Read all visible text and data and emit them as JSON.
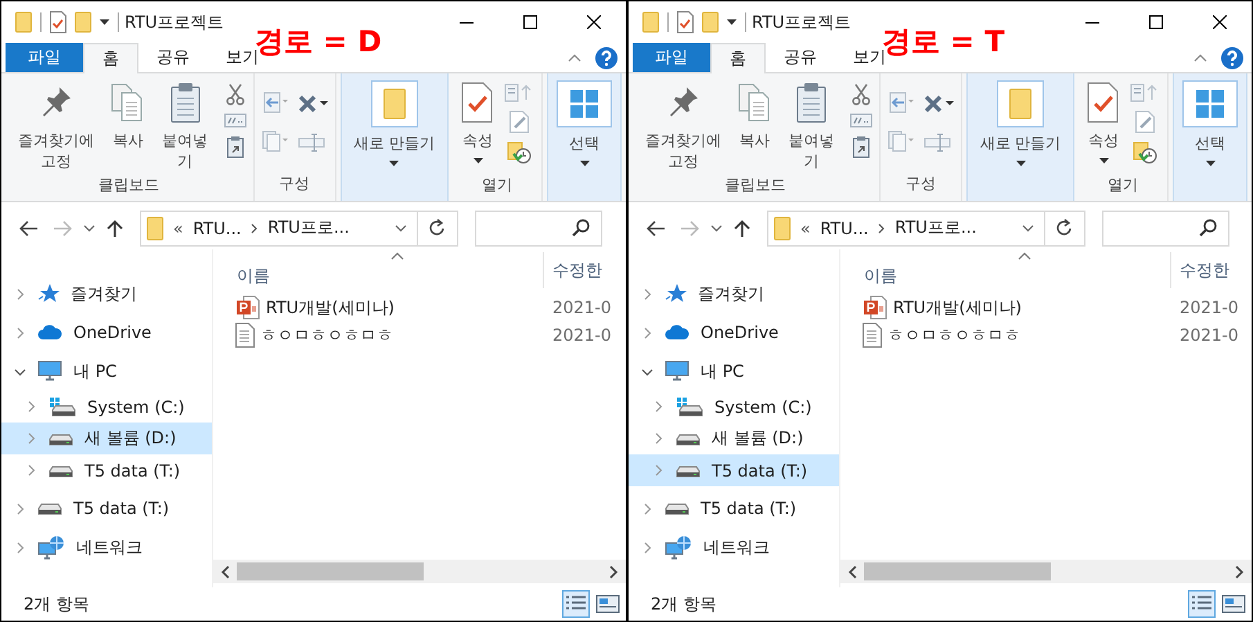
{
  "windows": [
    {
      "title": "RTU프로젝트",
      "annotation": "경로 = D",
      "tabs": [
        {
          "label": "파일",
          "kind": "file",
          "selected": false
        },
        {
          "label": "홈",
          "kind": "tab",
          "selected": true
        },
        {
          "label": "공유",
          "kind": "tab",
          "selected": false
        },
        {
          "label": "보기",
          "kind": "tab",
          "selected": false
        }
      ],
      "ribbon": [
        {
          "label": "클립보드",
          "highlighted": false,
          "items": [
            {
              "kind": "pin",
              "label": "즐겨찾기에 고정"
            },
            {
              "kind": "copy",
              "label": "복사"
            },
            {
              "kind": "paste",
              "label": "붙여넣기"
            },
            {
              "kind": "clip-stack"
            }
          ]
        },
        {
          "label": "구성",
          "highlighted": false,
          "items": [
            {
              "kind": "move-stack"
            },
            {
              "kind": "delete-stack"
            }
          ]
        },
        {
          "highlighted": true,
          "items": [
            {
              "kind": "new-folder",
              "label": "새로 만들기",
              "dropdown": true
            }
          ]
        },
        {
          "label": "열기",
          "highlighted": false,
          "items": [
            {
              "kind": "properties",
              "label": "속성",
              "dropdown": true
            },
            {
              "kind": "open-stack"
            }
          ]
        },
        {
          "highlighted": true,
          "items": [
            {
              "kind": "select",
              "label": "선택",
              "dropdown": true
            }
          ]
        }
      ],
      "address": {
        "overflow": "«",
        "crumbs": [
          "RTU...",
          "RTU프로..."
        ]
      },
      "nav": [
        {
          "label": "즐겨찾기",
          "kind": "star",
          "expanded": false,
          "selected": false
        },
        {
          "label": "OneDrive",
          "kind": "cloud",
          "expanded": false,
          "selected": false
        },
        {
          "label": "내 PC",
          "kind": "pc",
          "expanded": true,
          "selected": false,
          "children": [
            {
              "label": "System (C:)",
              "kind": "system-drive",
              "expanded": false,
              "selected": false
            },
            {
              "label": "새 볼륨 (D:)",
              "kind": "drive",
              "expanded": false,
              "selected": true
            },
            {
              "label": "T5 data (T:)",
              "kind": "drive",
              "expanded": false,
              "selected": false
            }
          ]
        },
        {
          "label": "T5 data (T:)",
          "kind": "drive",
          "expanded": false,
          "selected": false
        },
        {
          "label": "네트워크",
          "kind": "network",
          "expanded": false,
          "selected": false
        }
      ],
      "columns": [
        {
          "label": "이름",
          "sorted": true
        },
        {
          "label": "수정한",
          "sorted": false
        }
      ],
      "files": [
        {
          "name": "RTU개발(세미나)",
          "modified": "2021-0",
          "kind": "pptx"
        },
        {
          "name": "ㅎㅇㅁㅎㅇㅎㅁㅎ",
          "modified": "2021-0",
          "kind": "text"
        }
      ],
      "status": "2개 항목",
      "views": [
        {
          "kind": "details",
          "selected": true
        },
        {
          "kind": "tiles",
          "selected": false
        }
      ]
    },
    {
      "title": "RTU프로젝트",
      "annotation": "경로 = T",
      "tabs": [
        {
          "label": "파일",
          "kind": "file",
          "selected": false
        },
        {
          "label": "홈",
          "kind": "tab",
          "selected": true
        },
        {
          "label": "공유",
          "kind": "tab",
          "selected": false
        },
        {
          "label": "보기",
          "kind": "tab",
          "selected": false
        }
      ],
      "ribbon": [
        {
          "label": "클립보드",
          "highlighted": false,
          "items": [
            {
              "kind": "pin",
              "label": "즐겨찾기에 고정"
            },
            {
              "kind": "copy",
              "label": "복사"
            },
            {
              "kind": "paste",
              "label": "붙여넣기"
            },
            {
              "kind": "clip-stack"
            }
          ]
        },
        {
          "label": "구성",
          "highlighted": false,
          "items": [
            {
              "kind": "move-stack"
            },
            {
              "kind": "delete-stack"
            }
          ]
        },
        {
          "highlighted": true,
          "items": [
            {
              "kind": "new-folder",
              "label": "새로 만들기",
              "dropdown": true
            }
          ]
        },
        {
          "label": "열기",
          "highlighted": false,
          "items": [
            {
              "kind": "properties",
              "label": "속성",
              "dropdown": true
            },
            {
              "kind": "open-stack"
            }
          ]
        },
        {
          "highlighted": true,
          "items": [
            {
              "kind": "select",
              "label": "선택",
              "dropdown": true
            }
          ]
        }
      ],
      "address": {
        "overflow": "«",
        "crumbs": [
          "RTU...",
          "RTU프로..."
        ]
      },
      "nav": [
        {
          "label": "즐겨찾기",
          "kind": "star",
          "expanded": false,
          "selected": false
        },
        {
          "label": "OneDrive",
          "kind": "cloud",
          "expanded": false,
          "selected": false
        },
        {
          "label": "내 PC",
          "kind": "pc",
          "expanded": true,
          "selected": false,
          "children": [
            {
              "label": "System (C:)",
              "kind": "system-drive",
              "expanded": false,
              "selected": false
            },
            {
              "label": "새 볼륨 (D:)",
              "kind": "drive",
              "expanded": false,
              "selected": false
            },
            {
              "label": "T5 data (T:)",
              "kind": "drive",
              "expanded": false,
              "selected": true
            }
          ]
        },
        {
          "label": "T5 data (T:)",
          "kind": "drive",
          "expanded": false,
          "selected": false
        },
        {
          "label": "네트워크",
          "kind": "network",
          "expanded": false,
          "selected": false
        }
      ],
      "columns": [
        {
          "label": "이름",
          "sorted": true
        },
        {
          "label": "수정한",
          "sorted": false
        }
      ],
      "files": [
        {
          "name": "RTU개발(세미나)",
          "modified": "2021-0",
          "kind": "pptx"
        },
        {
          "name": "ㅎㅇㅁㅎㅇㅎㅁㅎ",
          "modified": "2021-0",
          "kind": "text"
        }
      ],
      "status": "2개 항목",
      "views": [
        {
          "kind": "details",
          "selected": true
        },
        {
          "kind": "tiles",
          "selected": false
        }
      ]
    }
  ]
}
